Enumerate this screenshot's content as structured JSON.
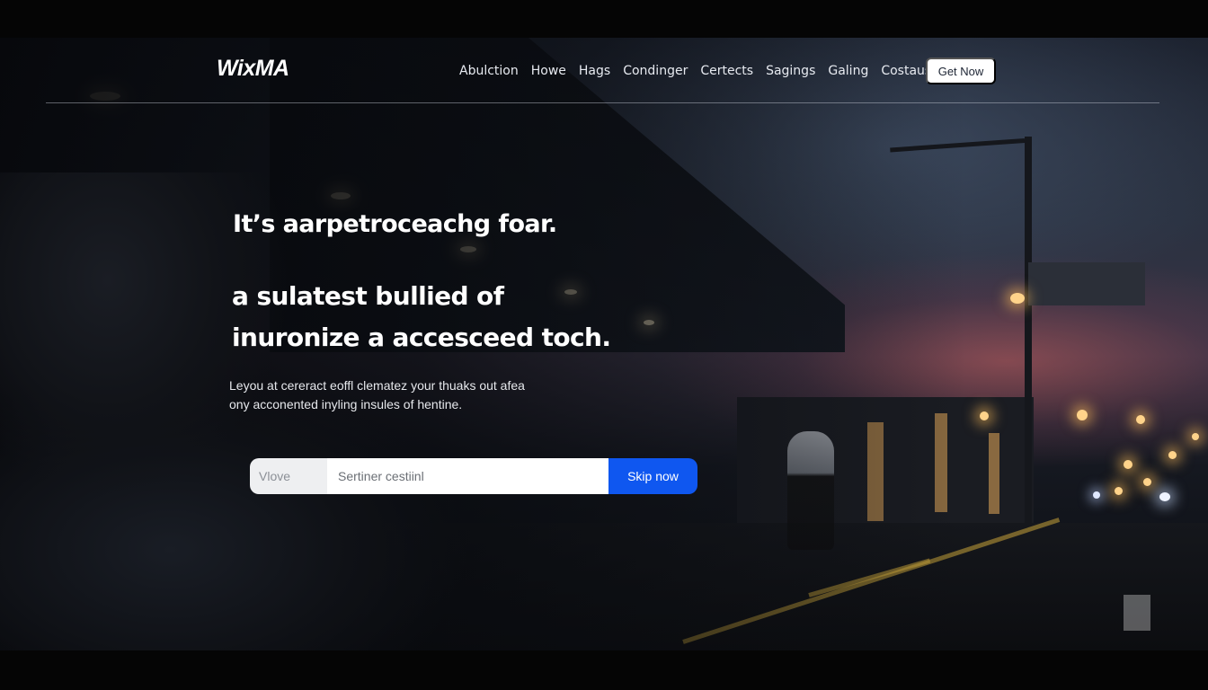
{
  "brand": {
    "logo": "WixMA"
  },
  "nav": {
    "links": [
      "Abulction",
      "Howe",
      "Hags",
      "Condinger",
      "Certects",
      "Sagings",
      "Galing",
      "Costaus"
    ],
    "cta_label": "Get Now"
  },
  "hero": {
    "eyebrow": "It’s aarpetroceachg foar.",
    "title_line1": "a sulatest bullied of",
    "title_line2": "inuronize a accesceed toch.",
    "subtitle_line1": "Leyou at cereract eoffl clematez your thuaks out afea",
    "subtitle_line2": "ony acconented inyling insules of hentine."
  },
  "form": {
    "select_value": "Vlove",
    "input_placeholder": "Sertiner cestiinl",
    "button_label": "Skip now"
  }
}
